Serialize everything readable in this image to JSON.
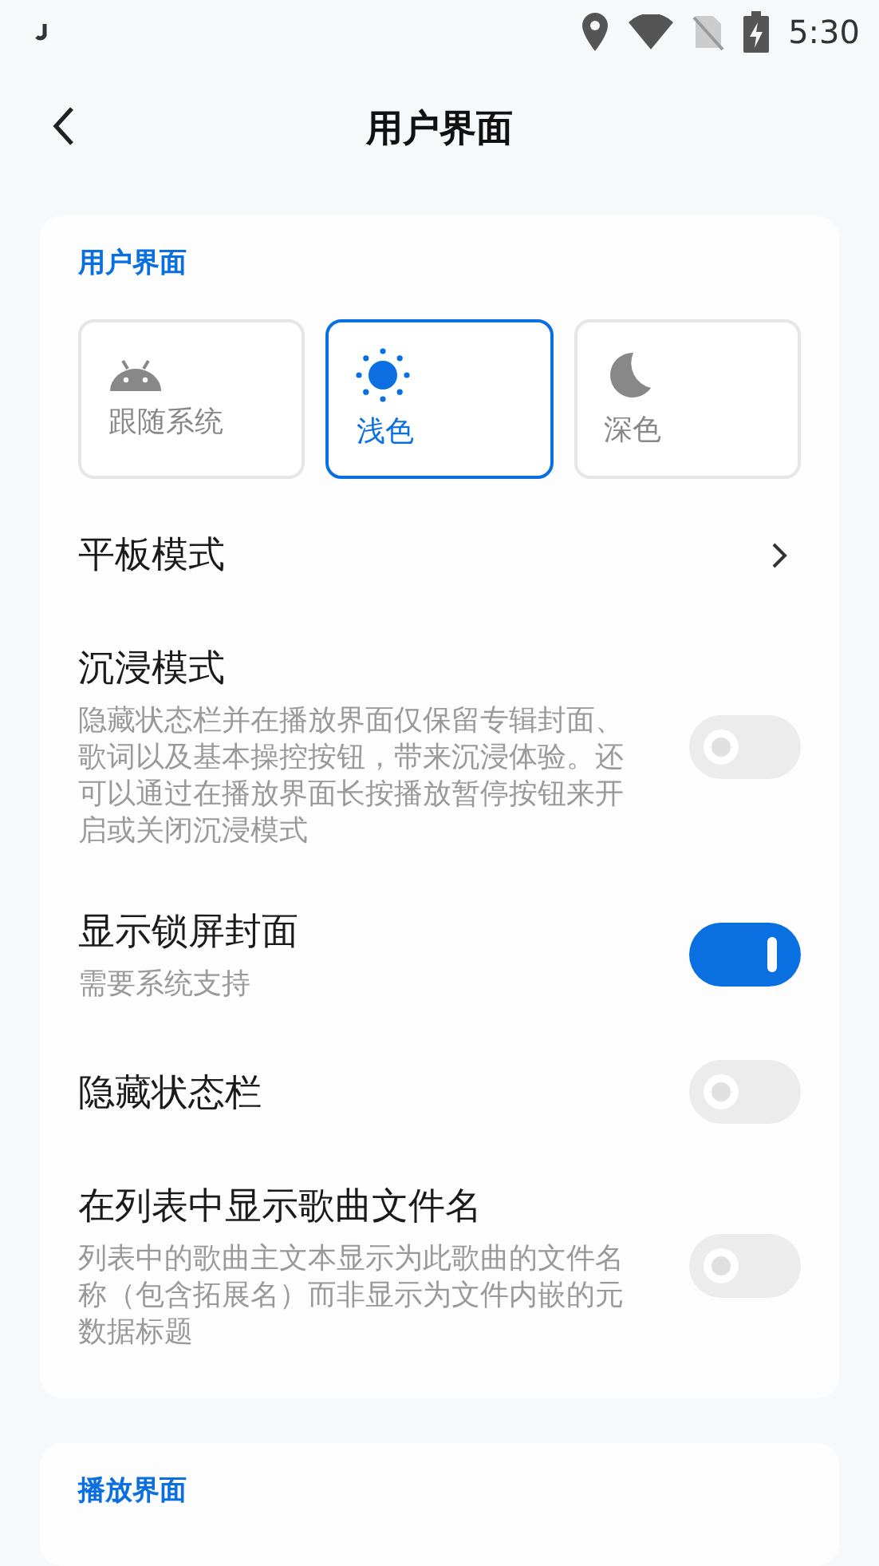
{
  "status_bar": {
    "time": "5:30"
  },
  "header": {
    "title": "用户界面"
  },
  "sections": [
    {
      "title": "用户界面",
      "theme_options": [
        {
          "label": "跟随系统",
          "selected": false
        },
        {
          "label": "浅色",
          "selected": true
        },
        {
          "label": "深色",
          "selected": false
        }
      ],
      "items": [
        {
          "kind": "link",
          "title": "平板模式"
        },
        {
          "kind": "switch",
          "title": "沉浸模式",
          "description": "隐藏状态栏并在播放界面仅保留专辑封面、歌词以及基本操控按钮，带来沉浸体验。还可以通过在播放界面长按播放暂停按钮来开启或关闭沉浸模式",
          "on": false
        },
        {
          "kind": "switch",
          "title": "显示锁屏封面",
          "description": "需要系统支持",
          "on": true
        },
        {
          "kind": "switch",
          "title": "隐藏状态栏",
          "on": false
        },
        {
          "kind": "switch",
          "title": "在列表中显示歌曲文件名",
          "description": "列表中的歌曲主文本显示为此歌曲的文件名称（包含拓展名）而非显示为文件内嵌的元数据标题",
          "on": false
        }
      ]
    },
    {
      "title": "播放界面"
    }
  ]
}
